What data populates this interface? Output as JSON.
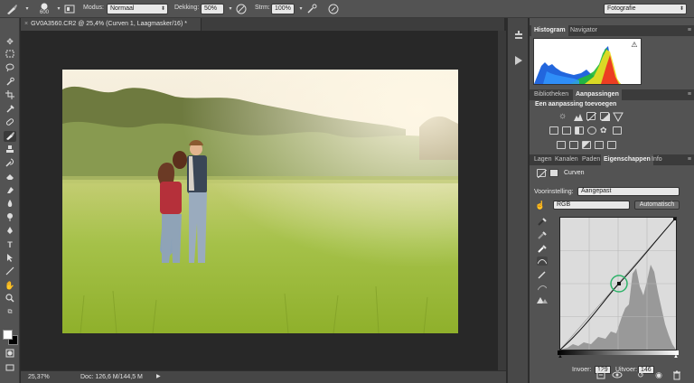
{
  "options_bar": {
    "brush_size": "600",
    "mode_label": "Modus:",
    "mode_value": "Normaal",
    "opacity_label": "Dekking:",
    "opacity_value": "50%",
    "flow_label": "Strm:",
    "flow_value": "100%",
    "workspace": "Fotografie"
  },
  "document": {
    "tab_title": "GV0A3560.CR2 @ 25,4% (Curven 1, Laagmasker/16) *",
    "zoom": "25,37%",
    "doc_size": "Doc: 126,6 M/144,5 M"
  },
  "panels": {
    "group1_tabs": [
      "Histogram",
      "Navigator"
    ],
    "group2_tabs": [
      "Bibliotheken",
      "Aanpassingen"
    ],
    "add_adjustment": "Een aanpassing toevoegen",
    "group3_tabs": [
      "Lagen",
      "Kanalen",
      "Paden",
      "Eigenschappen",
      "Info"
    ],
    "properties": {
      "title": "Curven",
      "preset_label": "Voorinstelling:",
      "preset_value": "Aangepast",
      "channel": "RGB",
      "auto_button": "Automatisch",
      "input_label": "Invoer:",
      "input_value": "129",
      "output_label": "Uitvoer:",
      "output_value": "146"
    }
  },
  "icons": {
    "tools": [
      "move-icon",
      "marquee-icon",
      "lasso-icon",
      "quick-select-icon",
      "crop-icon",
      "eyedropper-icon",
      "healing-icon",
      "brush-icon",
      "clone-stamp-icon",
      "history-brush-icon",
      "eraser-icon",
      "gradient-icon",
      "blur-icon",
      "dodge-icon",
      "pen-icon",
      "type-icon",
      "path-select-icon",
      "line-icon",
      "hand-icon",
      "zoom-icon"
    ]
  },
  "colors": {
    "foreground": "#ffffff",
    "background": "#000000",
    "curve_point_highlight": "#2fb36a"
  }
}
